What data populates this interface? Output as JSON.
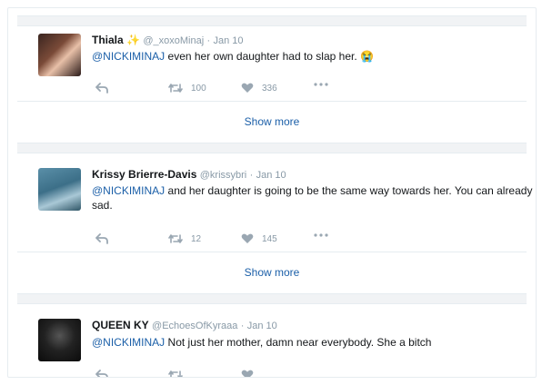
{
  "tweets": [
    {
      "name": "Thiala",
      "handle": "@_xoxoMinaj",
      "date": "Jan 10",
      "mention": "@NICKIMINAJ",
      "text": " even her own daughter had to slap her. 😭",
      "retweets": "100",
      "likes": "336"
    },
    {
      "name": "Krissy Brierre-Davis",
      "handle": "@krissybri",
      "date": "Jan 10",
      "mention": "@NICKIMINAJ",
      "text": " and her daughter is going to be the same way towards her. You can already see it. It's sad.",
      "retweets": "12",
      "likes": "145"
    },
    {
      "name": "QUEEN KY",
      "handle": "@EchoesOfKyraaa",
      "date": "Jan 10",
      "mention": "@NICKIMINAJ",
      "text": " Not just her mother, damn near everybody. She a bitch",
      "retweets": "",
      "likes": ""
    }
  ],
  "show_more_label": "Show more",
  "icons": {
    "name_badge": "sparkle-icon",
    "reply": "reply-icon",
    "retweet": "retweet-icon",
    "like": "heart-icon",
    "more": "more-dots-icon"
  }
}
